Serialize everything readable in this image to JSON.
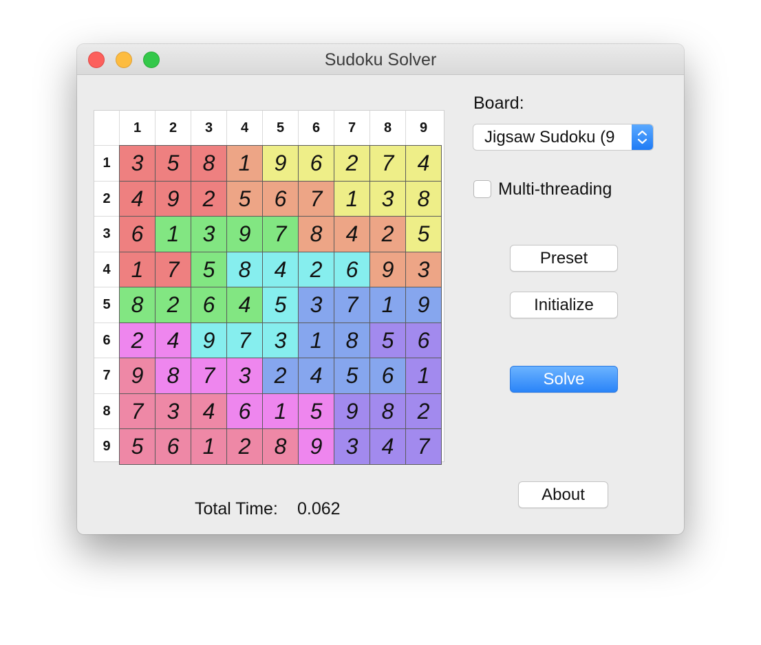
{
  "window": {
    "title": "Sudoku Solver"
  },
  "grid": {
    "column_headers": [
      "1",
      "2",
      "3",
      "4",
      "5",
      "6",
      "7",
      "8",
      "9"
    ],
    "row_headers": [
      "1",
      "2",
      "3",
      "4",
      "5",
      "6",
      "7",
      "8",
      "9"
    ],
    "values": [
      [
        "3",
        "5",
        "8",
        "1",
        "9",
        "6",
        "2",
        "7",
        "4"
      ],
      [
        "4",
        "9",
        "2",
        "5",
        "6",
        "7",
        "1",
        "3",
        "8"
      ],
      [
        "6",
        "1",
        "3",
        "9",
        "7",
        "8",
        "4",
        "2",
        "5"
      ],
      [
        "1",
        "7",
        "5",
        "8",
        "4",
        "2",
        "6",
        "9",
        "3"
      ],
      [
        "8",
        "2",
        "6",
        "4",
        "5",
        "3",
        "7",
        "1",
        "9"
      ],
      [
        "2",
        "4",
        "9",
        "7",
        "3",
        "1",
        "8",
        "5",
        "6"
      ],
      [
        "9",
        "8",
        "7",
        "3",
        "2",
        "4",
        "5",
        "6",
        "1"
      ],
      [
        "7",
        "3",
        "4",
        "6",
        "1",
        "5",
        "9",
        "8",
        "2"
      ],
      [
        "5",
        "6",
        "1",
        "2",
        "8",
        "9",
        "3",
        "4",
        "7"
      ]
    ],
    "regions": [
      [
        0,
        0,
        0,
        1,
        2,
        2,
        2,
        2,
        2
      ],
      [
        0,
        0,
        0,
        1,
        1,
        1,
        2,
        2,
        2
      ],
      [
        0,
        3,
        3,
        3,
        3,
        1,
        1,
        1,
        2
      ],
      [
        0,
        0,
        3,
        4,
        4,
        4,
        4,
        1,
        1
      ],
      [
        3,
        3,
        3,
        3,
        4,
        5,
        5,
        5,
        5
      ],
      [
        6,
        6,
        4,
        4,
        4,
        5,
        5,
        7,
        7
      ],
      [
        8,
        6,
        6,
        6,
        5,
        5,
        5,
        5,
        7
      ],
      [
        8,
        8,
        8,
        6,
        6,
        6,
        7,
        7,
        7
      ],
      [
        8,
        8,
        8,
        8,
        8,
        6,
        7,
        7,
        7
      ]
    ],
    "region_colors": [
      "#ee8080",
      "#eda586",
      "#eeee88",
      "#82e682",
      "#86eeee",
      "#86a6ee",
      "#ee86ee",
      "#a28aee",
      "#ee88a6"
    ]
  },
  "sidebar": {
    "board_label": "Board:",
    "board_select_value": "Jigsaw Sudoku (9",
    "multithreading_label": "Multi-threading",
    "multithreading_checked": false,
    "preset_button": "Preset",
    "initialize_button": "Initialize",
    "solve_button": "Solve",
    "about_button": "About"
  },
  "footer": {
    "total_time_label": "Total Time:",
    "total_time_value": "0.062"
  },
  "icons": {
    "window_controls": [
      "close-icon",
      "minimize-icon",
      "zoom-icon"
    ],
    "select": "updown-chevron-icon"
  }
}
